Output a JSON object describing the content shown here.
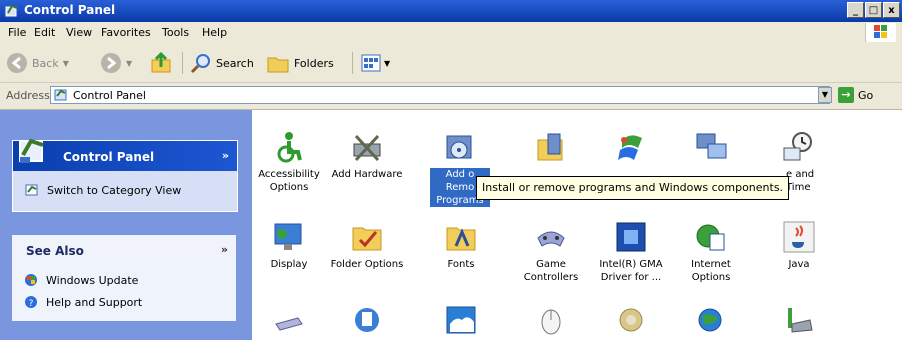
{
  "window": {
    "title": "Control Panel",
    "min": "_",
    "max": "□",
    "close": "x"
  },
  "menu": [
    "File",
    "Edit",
    "View",
    "Favorites",
    "Tools",
    "Help"
  ],
  "toolbar": {
    "back": "Back",
    "search": "Search",
    "folders": "Folders"
  },
  "address": {
    "label": "Address",
    "value": "Control Panel",
    "go": "Go"
  },
  "left_pane": {
    "control_panel": {
      "title": "Control Panel",
      "collapse": "»",
      "link": "Switch to Category View"
    },
    "see_also": {
      "title": "See Also",
      "collapse": "»",
      "links": [
        "Windows Update",
        "Help and Support"
      ]
    }
  },
  "items": [
    {
      "label": "Accessibility Options",
      "icon": "accessibility-icon"
    },
    {
      "label": "Add Hardware",
      "icon": "add-hardware-icon"
    },
    {
      "label": "Add or Remove Programs",
      "label_visible": "Add o\nRemo\nPrograms",
      "icon": "add-remove-programs-icon"
    },
    {
      "label": "",
      "icon": "administrative-tools-icon"
    },
    {
      "label": "",
      "icon": "automatic-updates-icon"
    },
    {
      "label": "",
      "icon": "network-setup-icon"
    },
    {
      "label": "e and Time",
      "icon": "date-time-icon"
    },
    {
      "label": "Display",
      "icon": "display-icon"
    },
    {
      "label": "Folder Options",
      "icon": "folder-options-icon"
    },
    {
      "label": "Fonts",
      "icon": "fonts-icon"
    },
    {
      "label": "Game Controllers",
      "icon": "game-controllers-icon"
    },
    {
      "label": "Intel(R) GMA Driver for ...",
      "icon": "intel-gma-icon"
    },
    {
      "label": "Internet Options",
      "icon": "internet-options-icon"
    },
    {
      "label": "Java",
      "icon": "java-icon"
    },
    {
      "label": "",
      "icon": "keyboard-icon"
    },
    {
      "label": "",
      "icon": "mail-icon"
    },
    {
      "label": "",
      "icon": "mesh-runtime-icon"
    },
    {
      "label": "",
      "icon": "mouse-icon"
    },
    {
      "label": "",
      "icon": "network-connections-icon"
    },
    {
      "label": "",
      "icon": "network-setup-wizard-icon"
    },
    {
      "label": "",
      "icon": "phone-modem-icon"
    }
  ],
  "tooltip": "Install or remove programs and Windows components."
}
